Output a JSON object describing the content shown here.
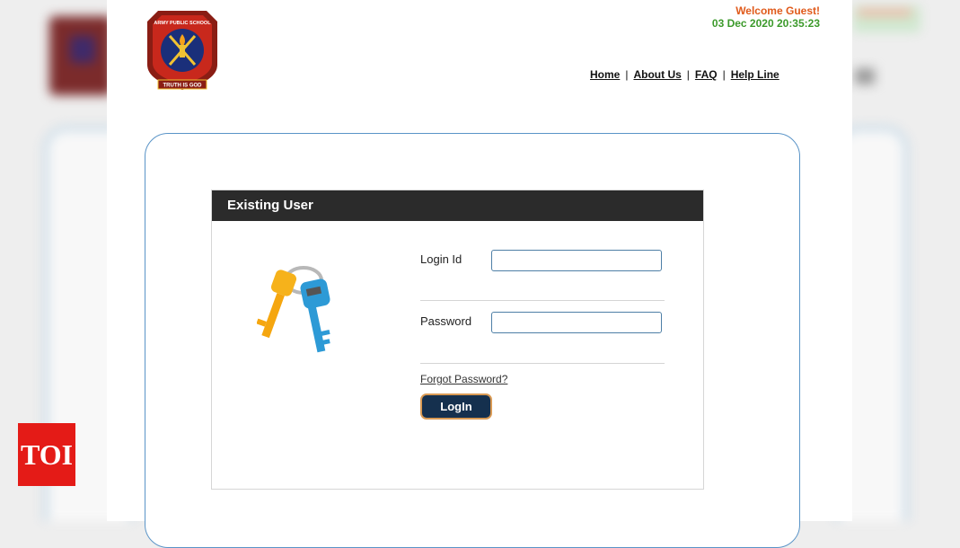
{
  "header": {
    "logo_text": {
      "top": "ARMY PUBLIC SCHOOL",
      "motto": "TRUTH IS GOD"
    },
    "welcome_text": "Welcome Guest!",
    "datetime": "03 Dec 2020 20:35:23",
    "nav": [
      {
        "label": "Home"
      },
      {
        "label": "About Us"
      },
      {
        "label": "FAQ"
      },
      {
        "label": "Help Line"
      }
    ],
    "nav_separator": "|"
  },
  "login": {
    "title": "Existing User",
    "login_id_label": "Login Id",
    "login_id_value": "",
    "password_label": "Password",
    "password_value": "",
    "forgot_password": "Forgot Password?",
    "login_button": "LogIn",
    "illustration": "keys-icon"
  },
  "watermark": {
    "text": "TOI"
  },
  "colors": {
    "welcome": "#e05a1b",
    "datetime": "#3c9a2b",
    "panel_border": "#5a94c7",
    "login_header": "#2b2b2b",
    "login_button": "#15304e",
    "watermark_bg": "#e41b17"
  }
}
